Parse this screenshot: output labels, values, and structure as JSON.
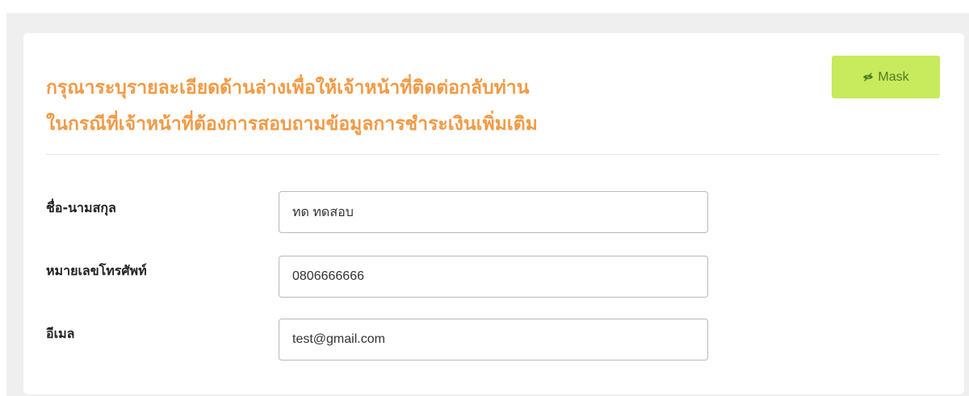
{
  "header": {
    "title_line1": "กรุณาระบุรายละเอียดด้านล่างเพื่อให้เจ้าหน้าที่ติดต่อกลับท่าน",
    "title_line2": "ในกรณีที่เจ้าหน้าที่ต้องการสอบถามข้อมูลการชำระเงินเพิ่มเติม",
    "mask_button": {
      "label": "Mask",
      "icon": "eye-slash-icon"
    }
  },
  "form": {
    "fields": [
      {
        "label": "ชื่อ-นามสกุล",
        "value": "ทด ทดสอบ"
      },
      {
        "label": "หมายเลขโทรศัพท์",
        "value": "0806666666"
      },
      {
        "label": "อีเมล",
        "value": "test@gmail.com"
      }
    ]
  },
  "colors": {
    "title": "#f29a45",
    "mask_button_bg": "#c8ea5d",
    "mask_button_text": "#4f7a23",
    "page_bg": "#efefef",
    "card_bg": "#ffffff",
    "input_border": "#b9b9b9"
  }
}
